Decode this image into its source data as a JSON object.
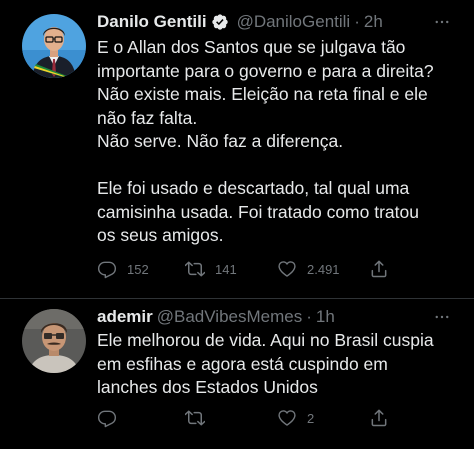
{
  "tweets": [
    {
      "author": {
        "display_name": "Danilo Gentili",
        "verified": true,
        "handle": "@DaniloGentili",
        "time": "2h"
      },
      "separator": "·",
      "body_lines": [
        "E o Allan dos Santos que se julgava tão",
        "importante para o governo e para a direita?",
        "Não existe mais. Eleição na reta final e ele",
        "não faz falta.",
        "Não serve. Não faz a diferença.",
        "",
        "Ele foi usado e descartado, tal qual uma",
        "camisinha usada. Foi tratado como tratou",
        "os seus amigos."
      ],
      "actions": {
        "replies": "152",
        "retweets": "141",
        "likes": "2.491"
      }
    },
    {
      "author": {
        "display_name": "ademir",
        "verified": false,
        "handle": "@BadVibesMemes",
        "time": "1h"
      },
      "separator": "·",
      "body_lines": [
        "Ele melhorou de vida. Aqui no Brasil cuspia",
        "em esfihas e agora está cuspindo em",
        "lanches dos Estados Unidos"
      ],
      "actions": {
        "replies": "",
        "retweets": "",
        "likes": "2"
      }
    }
  ],
  "colors": {
    "background": "#000000",
    "text_primary": "#e7e9ea",
    "text_secondary": "#71767b",
    "divider": "#2f3336",
    "verified_badge": "#1d9bf0"
  },
  "icons": {
    "more": "more-horizontal-icon",
    "reply": "reply-icon",
    "retweet": "retweet-icon",
    "like": "heart-icon",
    "share": "share-icon",
    "verified": "verified-badge-icon"
  }
}
